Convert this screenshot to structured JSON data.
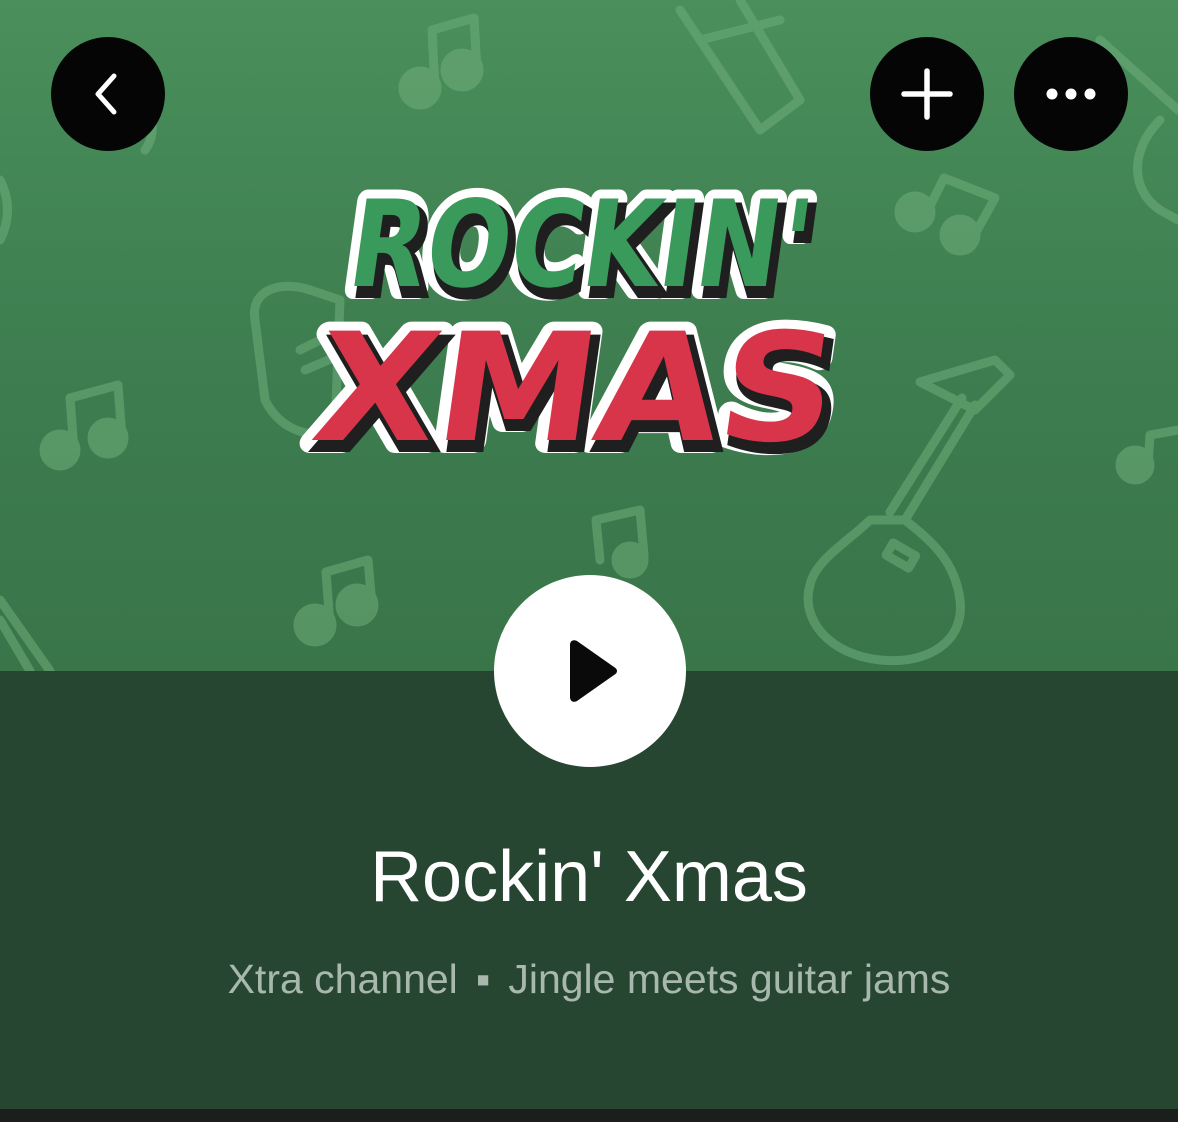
{
  "header": {
    "back_icon": "chevron-left-icon",
    "add_icon": "plus-icon",
    "more_icon": "ellipsis-icon"
  },
  "artwork": {
    "logo_line1": "ROCKIN'",
    "logo_line2": "XMAS",
    "colors": {
      "background": "#3f8052",
      "logo_green": "#3a9a5c",
      "logo_red": "#d8354a",
      "logo_shadow": "#1f1f1f",
      "logo_outline": "#ffffff"
    }
  },
  "player": {
    "play_icon": "play-icon"
  },
  "channel": {
    "title": "Rockin' Xmas",
    "type": "Xtra channel",
    "separator": "▪",
    "description": "Jingle meets guitar jams"
  }
}
